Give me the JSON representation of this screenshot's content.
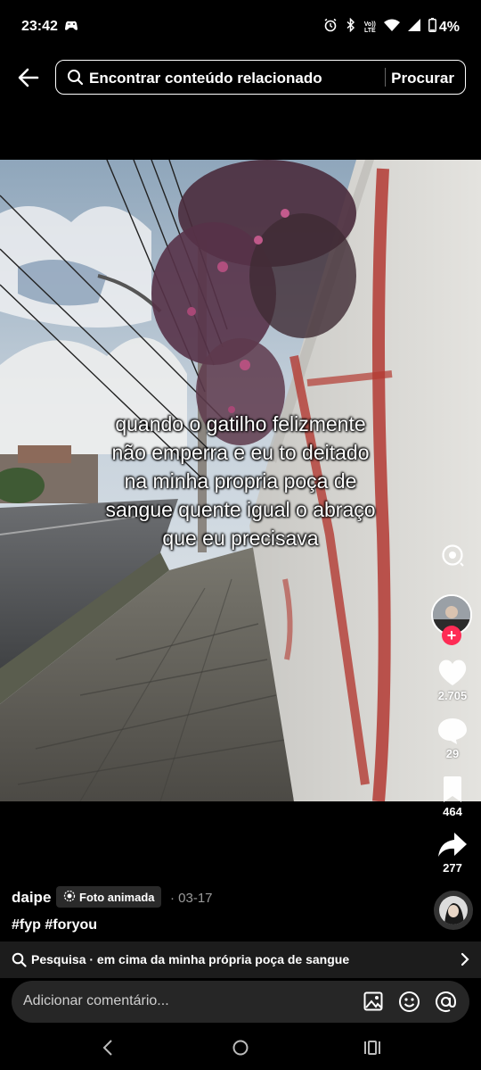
{
  "status_bar": {
    "time": "23:42",
    "lte_top": "Vo))",
    "lte_bottom": "LTE",
    "battery": "4%"
  },
  "header": {
    "search_placeholder": "Encontrar conteúdo relacionado",
    "search_button": "Procurar"
  },
  "post": {
    "caption_lines": [
      "quando o gatilho felizmente",
      "não emperra e eu to deitado",
      "na minha propria poça de",
      "sangue quente igual o abraço",
      "que eu precisava"
    ],
    "likes": "2.705",
    "comments": "29",
    "saves": "464",
    "shares": "277",
    "author": "daipe",
    "badge": "Foto animada",
    "date": "· 03-17",
    "hashtags": "#fyp #foryou"
  },
  "related_search": {
    "text": "Pesquisa · em cima da minha própria poça de sangue"
  },
  "comment_box": {
    "placeholder": "Adicionar comentário..."
  },
  "colors": {
    "accent": "#fe2c55",
    "background": "#000000"
  }
}
